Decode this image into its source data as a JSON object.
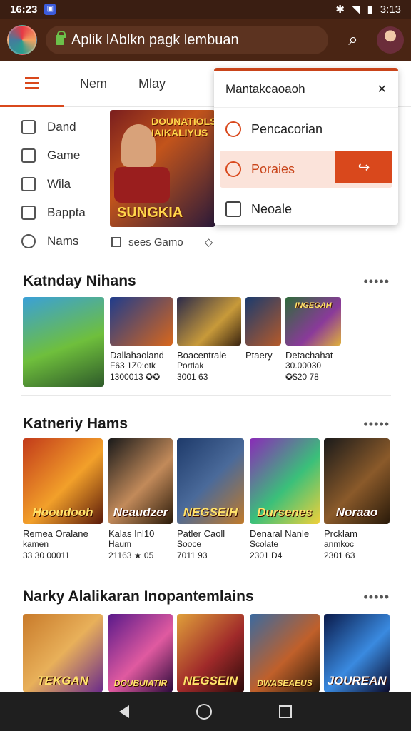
{
  "status": {
    "time": "16:23",
    "battery": "3:13"
  },
  "appbar": {
    "url_text": "Aplik lAblkn pagk lembuan"
  },
  "tabs": {
    "items": [
      "Nem",
      "Mlay"
    ]
  },
  "side_menu": {
    "items": [
      "Dand",
      "Game",
      "Wila",
      "Bappta",
      "Nams"
    ]
  },
  "banner": {
    "title_top": "DOUNATIOLS\nIAIKALIYUS",
    "title_bottom": "SUNGKIA"
  },
  "chips": {
    "label": "sees Gamo"
  },
  "dropdown": {
    "header": "Mantakcaoaoh",
    "items": [
      "Pencacorian",
      "Poraies",
      "Neoale"
    ]
  },
  "sections": [
    {
      "title": "Katnday Nihans",
      "more": "•••••",
      "cards": [
        {
          "l1": "",
          "l2": "",
          "l3": "",
          "thumb_text": ""
        },
        {
          "l1": "Dallahaoland",
          "l2": "F63 1Z0:otk",
          "l3": "1300013 ✪✪",
          "thumb_text": ""
        },
        {
          "l1": "Boacentrale",
          "l2": "Portlak",
          "l3": "3001 63",
          "thumb_text": ""
        },
        {
          "l1": "Ptaery",
          "l2": "",
          "l3": "",
          "thumb_text": ""
        },
        {
          "l1": "Detachahat",
          "l2": "30.00030",
          "l3": "✪$20 78",
          "thumb_text": "INGEGAH"
        }
      ]
    },
    {
      "title": "Katneriy Hams",
      "more": "•••••",
      "cards": [
        {
          "l1": "Remea Oralane",
          "l2": "kamen",
          "l3": "33 30 00011",
          "thumb_text": "Hooudooh"
        },
        {
          "l1": "Kalas Inl10",
          "l2": "Haum",
          "l3": "21163 ★ 05",
          "thumb_text": "Neaudzer"
        },
        {
          "l1": "Patler Caoll",
          "l2": "Sooce",
          "l3": "7011 93",
          "thumb_text": "NEGSEIH"
        },
        {
          "l1": "Denaral Nanle",
          "l2": "Scolate",
          "l3": "2301 D4",
          "thumb_text": "Dursenes"
        },
        {
          "l1": "Prcklam",
          "l2": "anmkoc",
          "l3": "2301 63",
          "thumb_text": "Noraao"
        }
      ]
    },
    {
      "title": "Narky Alalikaran Inopantemlains",
      "more": "•••••",
      "cards": [
        {
          "thumb_text": "TEKGAN"
        },
        {
          "thumb_text": "DOUBUIATIR"
        },
        {
          "thumb_text": "NEGSEIN"
        },
        {
          "thumb_text": "DWASEAEUS"
        },
        {
          "thumb_text": "JOUREAN"
        }
      ]
    }
  ],
  "colors": {
    "accent": "#d9481c",
    "appbar": "#4a2514",
    "statusbar": "#3a1e12"
  }
}
